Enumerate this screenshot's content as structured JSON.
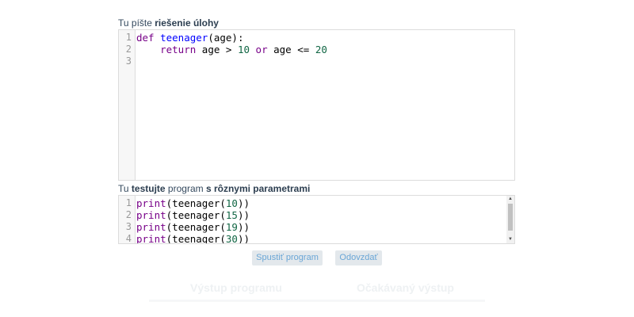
{
  "solution": {
    "label_prefix": "Tu píšte ",
    "label_bold": "riešenie úlohy",
    "lines": [
      {
        "n": "1",
        "tokens": [
          {
            "t": "def",
            "c": "kw"
          },
          {
            "t": " ",
            "c": ""
          },
          {
            "t": "teenager",
            "c": "fn"
          },
          {
            "t": "(age):",
            "c": ""
          }
        ]
      },
      {
        "n": "2",
        "tokens": [
          {
            "t": "    ",
            "c": ""
          },
          {
            "t": "return",
            "c": "kw"
          },
          {
            "t": " age > ",
            "c": ""
          },
          {
            "t": "10",
            "c": "num"
          },
          {
            "t": " ",
            "c": ""
          },
          {
            "t": "or",
            "c": "kw"
          },
          {
            "t": " age <= ",
            "c": ""
          },
          {
            "t": "20",
            "c": "num"
          }
        ]
      },
      {
        "n": "3",
        "tokens": []
      }
    ]
  },
  "test": {
    "label_p1": "Tu ",
    "label_b1": "testujte",
    "label_p2": " program ",
    "label_b2": "s rôznymi parametrami",
    "lines": [
      {
        "n": "1",
        "tokens": [
          {
            "t": "print",
            "c": "kw"
          },
          {
            "t": "(teenager(",
            "c": ""
          },
          {
            "t": "10",
            "c": "num"
          },
          {
            "t": "))",
            "c": ""
          }
        ]
      },
      {
        "n": "2",
        "tokens": [
          {
            "t": "print",
            "c": "kw"
          },
          {
            "t": "(teenager(",
            "c": ""
          },
          {
            "t": "15",
            "c": "num"
          },
          {
            "t": "))",
            "c": ""
          }
        ]
      },
      {
        "n": "3",
        "tokens": [
          {
            "t": "print",
            "c": "kw"
          },
          {
            "t": "(teenager(",
            "c": ""
          },
          {
            "t": "19",
            "c": "num"
          },
          {
            "t": "))",
            "c": ""
          }
        ]
      },
      {
        "n": "4",
        "tokens": [
          {
            "t": "print",
            "c": "kw"
          },
          {
            "t": "(teenager(",
            "c": ""
          },
          {
            "t": "30",
            "c": "num"
          },
          {
            "t": "))",
            "c": ""
          }
        ]
      }
    ],
    "scroll_up_icon": "▲",
    "scroll_down_icon": "▼"
  },
  "buttons": {
    "run": "Spustiť program",
    "submit": "Odovzdať"
  },
  "output": {
    "program_output": "Výstup programu",
    "expected_output": "Očakávaný výstup"
  },
  "colors": {
    "keyword": "#770088",
    "function": "#0000ff",
    "number": "#116644",
    "button_text": "#6aa6d6",
    "button_bg": "#e3e8ec"
  }
}
